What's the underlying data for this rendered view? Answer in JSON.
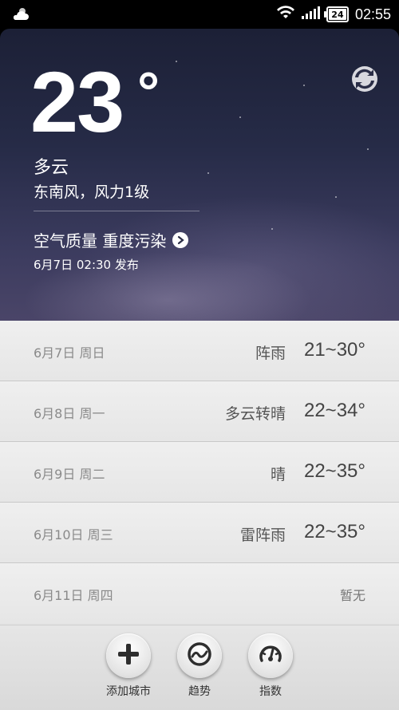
{
  "status_bar": {
    "battery": "24",
    "time": "02:55"
  },
  "current": {
    "temperature": "23",
    "unit": "°",
    "condition": "多云",
    "wind": "东南风，风力1级",
    "air_quality": "空气质量 重度污染",
    "published": "6月7日 02:30 发布"
  },
  "forecast": [
    {
      "date": "6月7日 周日",
      "weather": "阵雨",
      "range": "21~30°"
    },
    {
      "date": "6月8日 周一",
      "weather": "多云转晴",
      "range": "22~34°"
    },
    {
      "date": "6月9日 周二",
      "weather": "晴",
      "range": "22~35°"
    },
    {
      "date": "6月10日 周三",
      "weather": "雷阵雨",
      "range": "22~35°"
    },
    {
      "date": "6月11日 周四",
      "weather": "",
      "range": "暂无"
    }
  ],
  "toolbar": {
    "add_city": "添加城市",
    "trend": "趋势",
    "index": "指数"
  },
  "icons": {
    "weather_mini": "cloud-icon",
    "wifi": "wifi-icon",
    "signal": "signal-icon",
    "battery": "battery-icon",
    "refresh": "refresh-icon",
    "aqi_arrow": "chevron-right-icon",
    "add": "plus-icon",
    "trend": "trend-icon",
    "index": "gauge-icon"
  }
}
